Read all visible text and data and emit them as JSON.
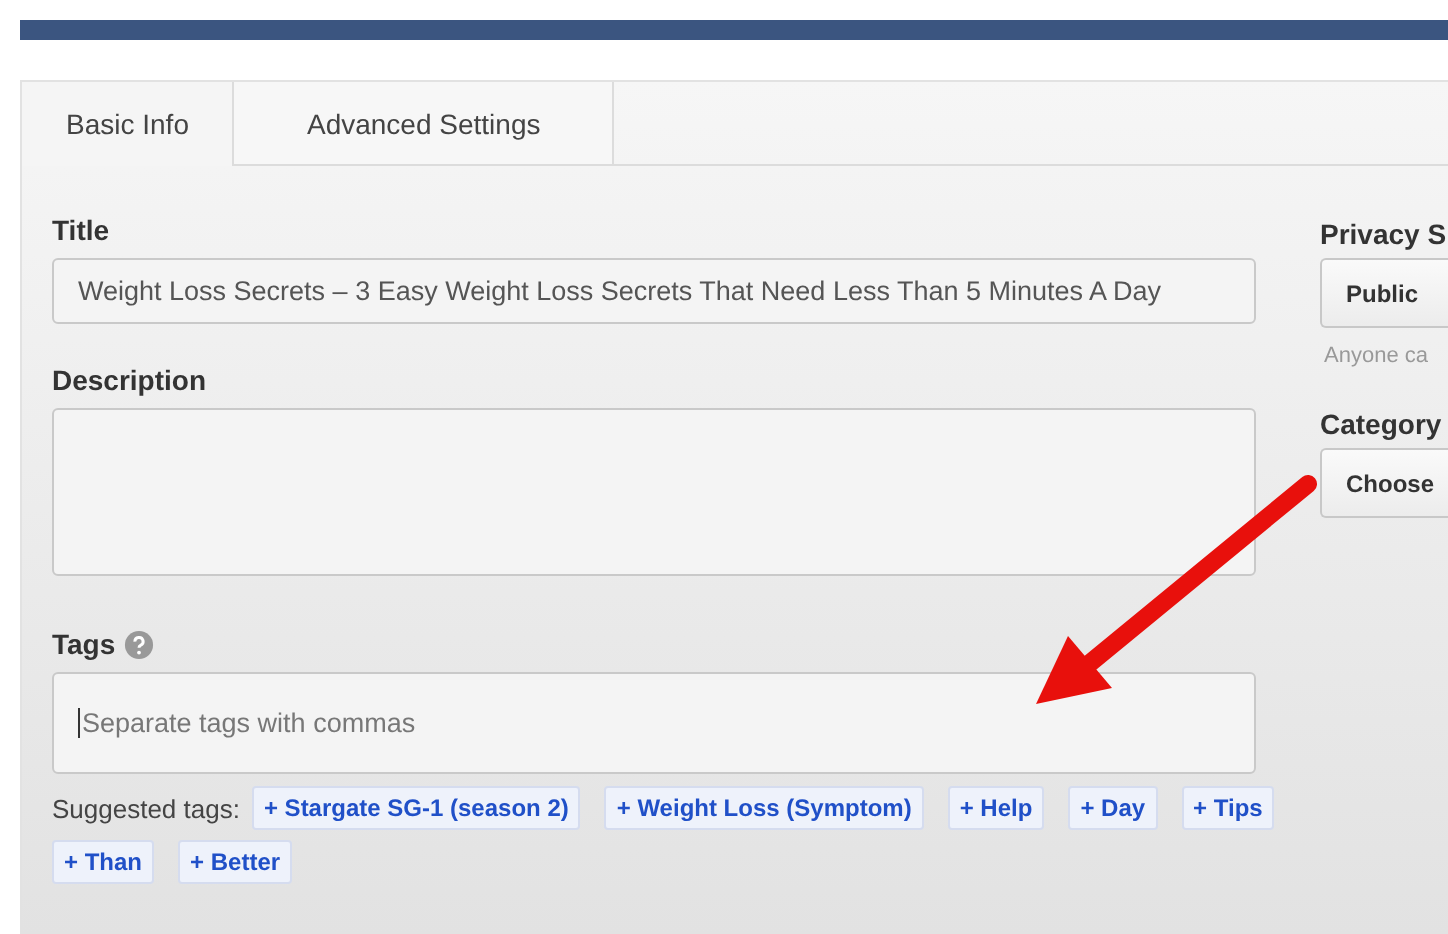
{
  "tabs": [
    {
      "label": "Basic Info",
      "selected": true
    },
    {
      "label": "Advanced Settings",
      "selected": false
    }
  ],
  "title_field": {
    "label": "Title",
    "value": "Weight Loss Secrets – 3 Easy Weight Loss Secrets That Need Less Than 5 Minutes A Day"
  },
  "description_field": {
    "label": "Description"
  },
  "tags_field": {
    "label": "Tags",
    "placeholder": "Separate tags with commas"
  },
  "suggested_tags": {
    "label": "Suggested tags:",
    "tags": [
      "+ Stargate SG-1 (season 2)",
      "+ Weight Loss (Symptom)",
      "+ Help",
      "+ Day",
      "+ Tips",
      "+ Than",
      "+ Better"
    ]
  },
  "privacy": {
    "label": "Privacy S",
    "value": "Public",
    "hint": "Anyone ca"
  },
  "category": {
    "label": "Category",
    "value": "Choose"
  }
}
